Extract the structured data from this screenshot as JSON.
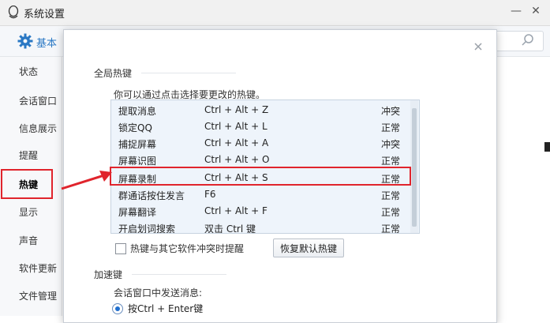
{
  "window": {
    "title": "系统设置",
    "minimize_glyph": "—",
    "close_glyph": "✕"
  },
  "toolbar": {
    "basic_label": "基本"
  },
  "sidebar": {
    "items": [
      {
        "label": "状态"
      },
      {
        "label": "会话窗口"
      },
      {
        "label": "信息展示"
      },
      {
        "label": "提醒"
      },
      {
        "label": "热键",
        "active": true
      },
      {
        "label": "显示"
      },
      {
        "label": "声音"
      },
      {
        "label": "软件更新"
      },
      {
        "label": "文件管理"
      }
    ]
  },
  "dialog": {
    "global_hotkeys_title": "全局热键",
    "instruction": "你可以通过点击选择要更改的热键。",
    "hotkeys": [
      {
        "name": "提取消息",
        "key": "Ctrl + Alt + Z",
        "status": "冲突"
      },
      {
        "name": "锁定QQ",
        "key": "Ctrl + Alt + L",
        "status": "正常"
      },
      {
        "name": "捕捉屏幕",
        "key": "Ctrl + Alt + A",
        "status": "冲突"
      },
      {
        "name": "屏幕识图",
        "key": "Ctrl + Alt + O",
        "status": "正常"
      },
      {
        "name": "屏幕录制",
        "key": "Ctrl + Alt + S",
        "status": "正常"
      },
      {
        "name": "群通话按住发言",
        "key": "F6",
        "status": "正常"
      },
      {
        "name": "屏幕翻译",
        "key": "Ctrl + Alt + F",
        "status": "正常"
      },
      {
        "name": "开启划词搜索",
        "key": "双击 Ctrl 键",
        "status": "正常"
      }
    ],
    "conflict_checkbox_label": "热键与其它软件冲突时提醒",
    "conflict_checkbox_checked": false,
    "restore_button_label": "恢复默认热键",
    "accel_title": "加速键",
    "send_message_label": "会话窗口中发送消息:",
    "send_option_label": "按Ctrl + Enter键",
    "send_option_selected": true
  },
  "colors": {
    "highlight_red": "#e0242c",
    "accent_blue": "#2a78c4",
    "list_bg": "#eef4fb"
  }
}
